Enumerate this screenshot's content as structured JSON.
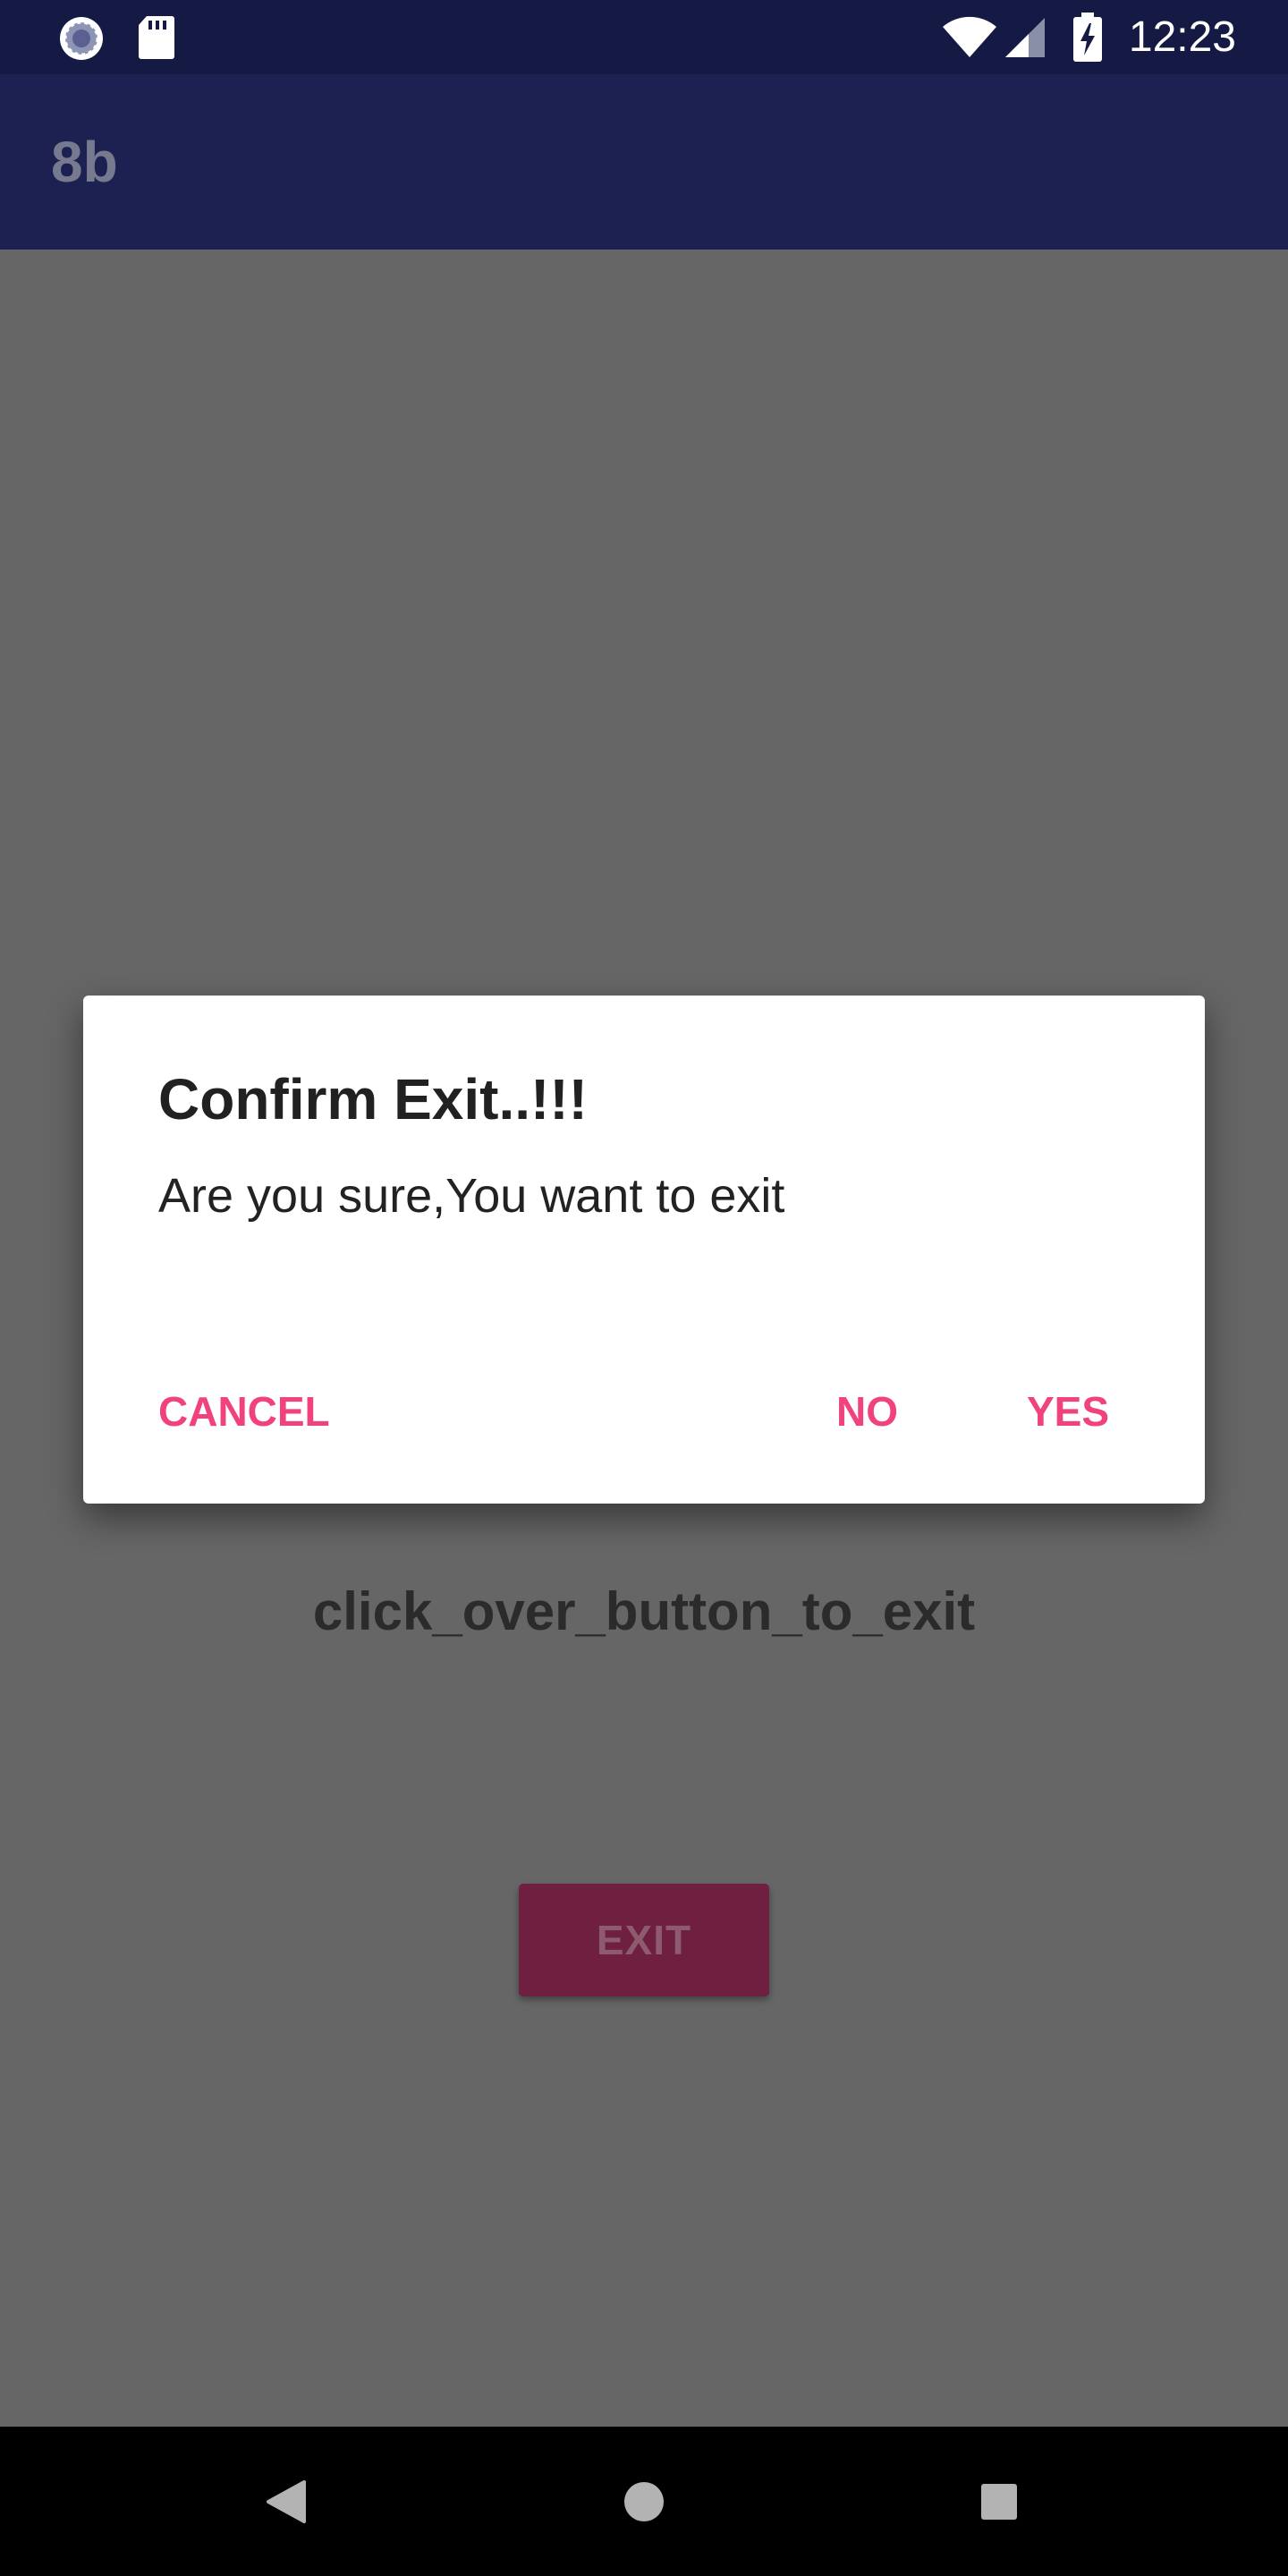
{
  "status_bar": {
    "time": "12:23",
    "left_icons": [
      "sync-icon",
      "sd-card-icon"
    ],
    "right_icons": [
      "wifi-icon",
      "signal-icon",
      "battery-charging-icon"
    ]
  },
  "app_bar": {
    "title": "8b"
  },
  "main": {
    "instruction": "click_over_button_to_exit",
    "exit_button_label": "EXIT"
  },
  "dialog": {
    "title": "Confirm Exit..!!!",
    "message": "Are you sure,You want to exit",
    "buttons": {
      "cancel": "CANCEL",
      "no": "NO",
      "yes": "YES"
    }
  },
  "nav_bar": {
    "buttons": [
      "back-icon",
      "home-icon",
      "recents-icon"
    ]
  },
  "colors": {
    "status_bar": "#141a44",
    "app_bar": "#1c2152",
    "scrim_background": "#666666",
    "dialog_button_text": "#f0427c",
    "exit_button": "#6f1f3f"
  }
}
